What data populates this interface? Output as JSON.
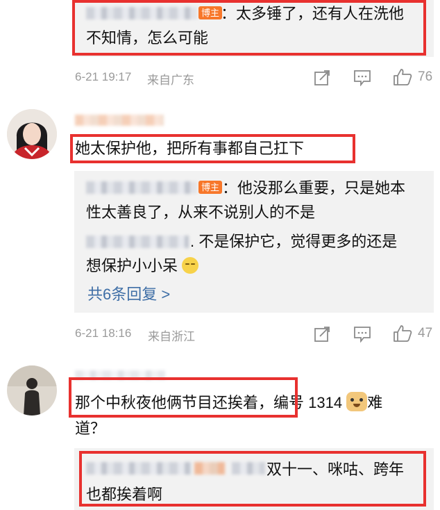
{
  "comment1": {
    "reply": {
      "badge": "博主",
      "line1": "：太多锤了，还有人在洗他",
      "line2": "不知情，怎么可能"
    },
    "meta": {
      "time": "6-21 19:17",
      "location": "来自广东",
      "likes": "76",
      "icons": [
        "share-icon",
        "comment-icon",
        "like-icon"
      ]
    }
  },
  "comment2": {
    "text": "她太保护他，把所有事都自己扛下",
    "replies": [
      {
        "badge": "博主",
        "line1": "：他没那么重要，只是她本",
        "line2": "性太善良了，从来不说别人的不是"
      },
      {
        "line1": ". 不是保护它，觉得更多的还是",
        "line2": "想保护小小呆"
      }
    ],
    "more_replies": "共6条回复 >",
    "meta": {
      "time": "6-21 18:16",
      "location": "来自浙江",
      "likes": "47",
      "icons": [
        "share-icon",
        "comment-icon",
        "like-icon"
      ]
    }
  },
  "comment3": {
    "text_highlight": "那个中秋夜他俩节目还挨着",
    "text_rest": "，编号 1314",
    "text_tail": "难",
    "line2": "道？",
    "reply": {
      "line1": "双十一、咪咕、跨年",
      "line2": "也都挨着啊"
    }
  },
  "colors": {
    "highlight_border": "#e8312f",
    "badge": "#f7772a",
    "link": "#3e6ea6",
    "meta_text": "#9a9a9a",
    "reply_bg": "#f2f2f2"
  }
}
